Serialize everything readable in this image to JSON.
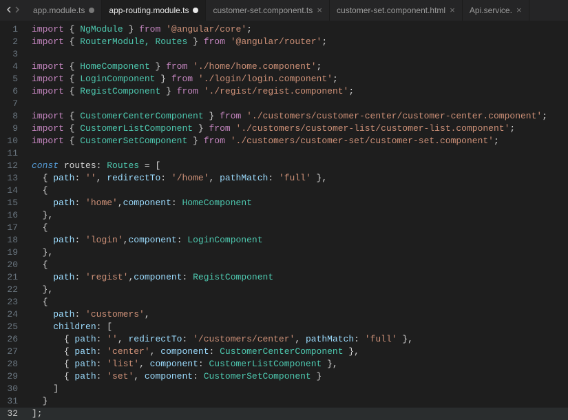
{
  "tabs": [
    {
      "label": "app.module.ts",
      "active": false,
      "dirty": true
    },
    {
      "label": "app-routing.module.ts",
      "active": true,
      "dirty": true
    },
    {
      "label": "customer-set.component.ts",
      "active": false,
      "dirty": false
    },
    {
      "label": "customer-set.component.html",
      "active": false,
      "dirty": false
    },
    {
      "label": "Api.service.",
      "active": false,
      "dirty": false
    }
  ],
  "lineCount": 32,
  "activeLine": 32,
  "code": {
    "imports": [
      {
        "symbols": "NgModule",
        "from": "@angular/core"
      },
      {
        "symbols": "RouterModule, Routes",
        "from": "@angular/router"
      },
      {
        "blank": true
      },
      {
        "symbols": "HomeComponent",
        "from": "./home/home.component"
      },
      {
        "symbols": "LoginComponent",
        "from": "./login/login.component"
      },
      {
        "symbols": "RegistComponent",
        "from": "./regist/regist.component"
      },
      {
        "blank": true
      },
      {
        "symbols": "CustomerCenterComponent",
        "from": "./customers/customer-center/customer-center.component"
      },
      {
        "symbols": "CustomerListComponent",
        "from": "./customers/customer-list/customer-list.component"
      },
      {
        "symbols": "CustomerSetComponent",
        "from": "./customers/customer-set/customer-set.component"
      }
    ],
    "constDecl": {
      "keyword": "const",
      "name": "routes",
      "type": "Routes"
    },
    "routes": [
      {
        "inline": true,
        "path": "",
        "redirectTo": "/home",
        "pathMatch": "full"
      },
      {
        "inline": false,
        "path": "home",
        "component": "HomeComponent"
      },
      {
        "inline": false,
        "path": "login",
        "component": "LoginComponent"
      },
      {
        "inline": false,
        "path": "regist",
        "component": "RegistComponent"
      },
      {
        "inline": false,
        "path": "customers",
        "children": [
          {
            "path": "",
            "redirectTo": "/customers/center",
            "pathMatch": "full"
          },
          {
            "path": "center",
            "component": "CustomerCenterComponent"
          },
          {
            "path": "list",
            "component": "CustomerListComponent"
          },
          {
            "path": "set",
            "component": "CustomerSetComponent"
          }
        ]
      }
    ]
  }
}
